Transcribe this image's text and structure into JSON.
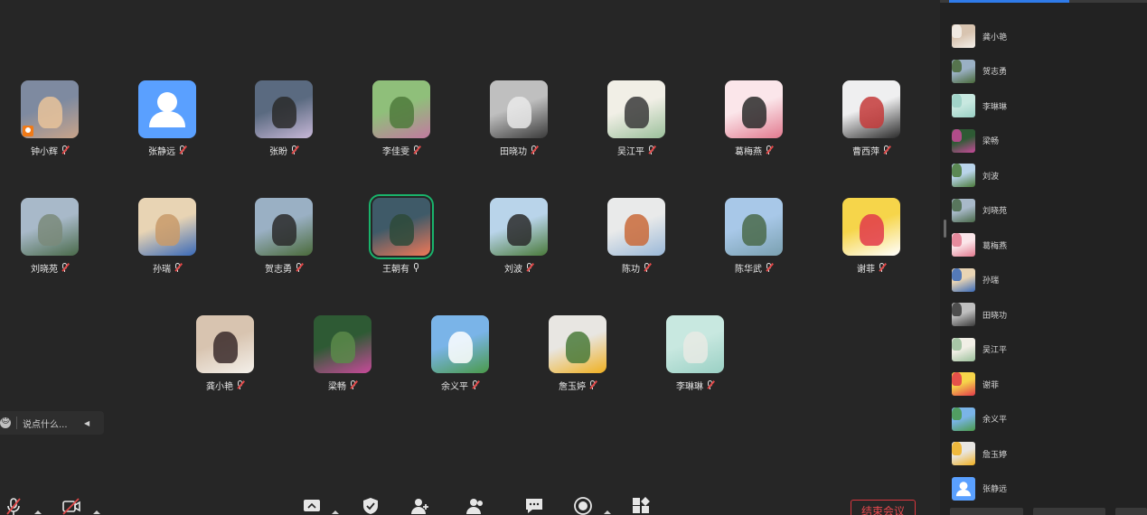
{
  "participants_grid": [
    {
      "name": "钟小辉",
      "mic": "muted",
      "host": true,
      "colors": [
        "#7e8aa0",
        "#c9a48a",
        "#e9c39a"
      ]
    },
    {
      "name": "张静远",
      "mic": "muted",
      "host": false,
      "colors": [
        "#5aa0ff",
        "#5aa0ff",
        "#ffffff"
      ],
      "icon": "default-user-icon"
    },
    {
      "name": "张盼",
      "mic": "muted",
      "host": false,
      "colors": [
        "#5a6a80",
        "#c8b8d8",
        "#2a2a2a"
      ]
    },
    {
      "name": "李佳雯",
      "mic": "muted",
      "host": false,
      "colors": [
        "#8fbf7a",
        "#c27aa0",
        "#4f7a3c"
      ]
    },
    {
      "name": "田晓功",
      "mic": "muted",
      "host": false,
      "colors": [
        "#bfbfbf",
        "#3a3a3a",
        "#e9e9e9"
      ]
    },
    {
      "name": "吴江平",
      "mic": "muted",
      "host": false,
      "colors": [
        "#f1efe6",
        "#9bc09b",
        "#3a3a3a"
      ]
    },
    {
      "name": "葛梅燕",
      "mic": "muted",
      "host": false,
      "colors": [
        "#fbe6ea",
        "#e27a8f",
        "#2a2a2a"
      ]
    },
    {
      "name": "曹西萍",
      "mic": "muted",
      "host": false,
      "colors": [
        "#efeff0",
        "#2a2a2a",
        "#c43a3a"
      ]
    },
    {
      "name": "刘晓苑",
      "mic": "muted",
      "host": false,
      "colors": [
        "#a8b9c9",
        "#4a6a4a",
        "#7a8a7a"
      ]
    },
    {
      "name": "孙瑞",
      "mic": "muted",
      "host": false,
      "colors": [
        "#e8d4b4",
        "#3a6ab8",
        "#c89a6a"
      ]
    },
    {
      "name": "贺志勇",
      "mic": "muted",
      "host": false,
      "colors": [
        "#9ab0c4",
        "#4a6a3a",
        "#2a2a2a"
      ]
    },
    {
      "name": "王朝有",
      "mic": "on",
      "host": false,
      "active": true,
      "colors": [
        "#3f5a68",
        "#f07858",
        "#2e4a3a"
      ]
    },
    {
      "name": "刘波",
      "mic": "muted",
      "host": false,
      "colors": [
        "#b9d4ea",
        "#4a7a3a",
        "#2a2a2a"
      ]
    },
    {
      "name": "陈功",
      "mic": "muted",
      "host": false,
      "colors": [
        "#e9eaea",
        "#9ab8d8",
        "#c96a3a"
      ]
    },
    {
      "name": "陈华武",
      "mic": "muted",
      "host": false,
      "colors": [
        "#a8c8e8",
        "#7aa0b0",
        "#4a6a4a"
      ]
    },
    {
      "name": "谢菲",
      "mic": "muted",
      "host": false,
      "colors": [
        "#f6d54a",
        "#ffffff",
        "#e23a4a"
      ]
    },
    {
      "name": "龚小艳",
      "mic": "muted",
      "host": false,
      "colors": [
        "#d8c4b0",
        "#f4f0ea",
        "#3a2a2a"
      ]
    },
    {
      "name": "梁畅",
      "mic": "muted",
      "host": false,
      "colors": [
        "#2e5a34",
        "#c84a9a",
        "#5a8a4a"
      ]
    },
    {
      "name": "余义平",
      "mic": "muted",
      "host": false,
      "colors": [
        "#7ab4e8",
        "#4a9a4a",
        "#ffffff"
      ]
    },
    {
      "name": "詹玉婷",
      "mic": "muted",
      "host": false,
      "colors": [
        "#e8e6e2",
        "#f0b020",
        "#4a7a3a"
      ]
    },
    {
      "name": "李琳琳",
      "mic": "muted",
      "host": false,
      "colors": [
        "#c8e8e0",
        "#9ad0c4",
        "#e8eae4"
      ]
    }
  ],
  "side_panel": {
    "participants": [
      {
        "name": "龚小艳",
        "colors": [
          "#d8c4b0",
          "#f4f0ea"
        ]
      },
      {
        "name": "贺志勇",
        "colors": [
          "#9ab0c4",
          "#4a6a3a"
        ]
      },
      {
        "name": "李琳琳",
        "colors": [
          "#c8e8e0",
          "#9ad0c4"
        ]
      },
      {
        "name": "梁畅",
        "colors": [
          "#2e5a34",
          "#c84a9a"
        ]
      },
      {
        "name": "刘波",
        "colors": [
          "#b9d4ea",
          "#4a7a3a"
        ]
      },
      {
        "name": "刘晓苑",
        "colors": [
          "#a8b9c9",
          "#4a6a4a"
        ]
      },
      {
        "name": "葛梅燕",
        "colors": [
          "#fbe6ea",
          "#e27a8f"
        ]
      },
      {
        "name": "孙瑞",
        "colors": [
          "#e8d4b4",
          "#3a6ab8"
        ]
      },
      {
        "name": "田晓功",
        "colors": [
          "#bfbfbf",
          "#3a3a3a"
        ]
      },
      {
        "name": "吴江平",
        "colors": [
          "#f1efe6",
          "#9bc09b"
        ]
      },
      {
        "name": "谢菲",
        "colors": [
          "#f6d54a",
          "#e23a4a"
        ]
      },
      {
        "name": "余义平",
        "colors": [
          "#7ab4e8",
          "#4a9a4a"
        ]
      },
      {
        "name": "詹玉婷",
        "colors": [
          "#e8e6e2",
          "#f0b020"
        ]
      },
      {
        "name": "张静远",
        "colors": [
          "#5aa0ff",
          "#ffffff"
        ],
        "icon": "default-user-icon"
      }
    ]
  },
  "chat": {
    "placeholder": "说点什么...",
    "emoji_icon": "emoji-icon",
    "collapse_icon": "collapse-left-icon"
  },
  "toolbar": {
    "icons": [
      "mic-muted-icon",
      "camera-off-icon",
      "share-screen-icon",
      "security-shield-icon",
      "invite-user-icon",
      "participants-icon",
      "chat-icon",
      "record-icon",
      "apps-icon"
    ],
    "end_meeting_label": "结束会议"
  },
  "accent": {
    "active_speaker": "#19b36b",
    "end_button": "#e84a4f",
    "active_tab": "#2f7bea"
  }
}
